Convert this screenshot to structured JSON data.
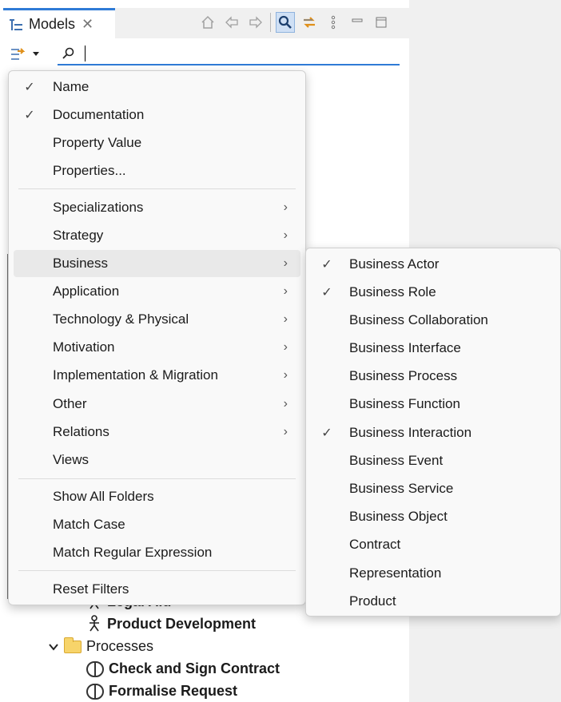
{
  "tab": {
    "title": "Models",
    "close": "✕"
  },
  "toolbar": {
    "icons": [
      "home-icon",
      "back-icon",
      "forward-icon",
      "search-icon",
      "sync-icon",
      "more-icon",
      "minimize-icon",
      "maximize-icon"
    ]
  },
  "search": {
    "value": ""
  },
  "filter_menu": {
    "items": [
      {
        "label": "Name",
        "checked": true
      },
      {
        "label": "Documentation",
        "checked": true
      },
      {
        "label": "Property Value",
        "checked": false
      },
      {
        "label": "Properties...",
        "checked": false
      },
      {
        "label": "Specializations",
        "submenu": true
      },
      {
        "label": "Strategy",
        "submenu": true
      },
      {
        "label": "Business",
        "submenu": true,
        "highlighted": true
      },
      {
        "label": "Application",
        "submenu": true
      },
      {
        "label": "Technology & Physical",
        "submenu": true
      },
      {
        "label": "Motivation",
        "submenu": true
      },
      {
        "label": "Implementation & Migration",
        "submenu": true
      },
      {
        "label": "Other",
        "submenu": true
      },
      {
        "label": "Relations",
        "submenu": true
      },
      {
        "label": "Views",
        "submenu": false
      },
      {
        "label": "Show All Folders"
      },
      {
        "label": "Match Case"
      },
      {
        "label": "Match Regular Expression"
      },
      {
        "label": "Reset Filters"
      }
    ],
    "check_glyph": "✓",
    "arrow_glyph": "›"
  },
  "business_submenu": {
    "items": [
      {
        "label": "Business Actor",
        "checked": true
      },
      {
        "label": "Business Role",
        "checked": true
      },
      {
        "label": "Business Collaboration",
        "checked": false
      },
      {
        "label": "Business Interface",
        "checked": false
      },
      {
        "label": "Business Process",
        "checked": false
      },
      {
        "label": "Business Function",
        "checked": false
      },
      {
        "label": "Business Interaction",
        "checked": true
      },
      {
        "label": "Business Event",
        "checked": false
      },
      {
        "label": "Business Service",
        "checked": false
      },
      {
        "label": "Business Object",
        "checked": false
      },
      {
        "label": "Contract",
        "checked": false
      },
      {
        "label": "Representation",
        "checked": false
      },
      {
        "label": "Product",
        "checked": false
      }
    ]
  },
  "tree": {
    "partial_item": "Legal Aid",
    "actor_item": "Product Development",
    "folder": "Processes",
    "process_items": [
      "Check and  Sign Contract",
      "Formalise Request"
    ]
  },
  "colors": {
    "accent": "#2f7bd6",
    "folder": "#f7d46a",
    "menu_bg": "#f9f9f9",
    "highlight": "#e9e9e9"
  }
}
